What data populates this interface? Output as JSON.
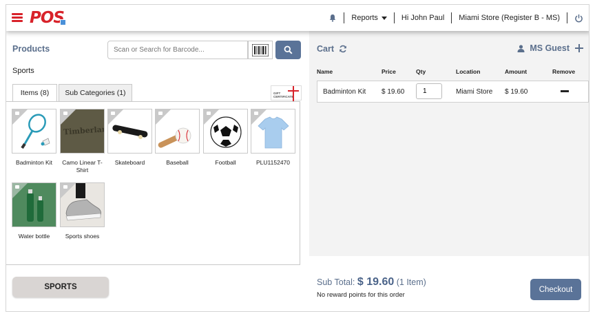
{
  "header": {
    "logo_text": "POS",
    "icons": {
      "menu": "hamburger-icon",
      "notifications": "bell-icon",
      "logout": "power-icon"
    },
    "reports_label": "Reports",
    "greeting": "Hi John Paul",
    "store": "Miami Store (Register B - MS)"
  },
  "products": {
    "title": "Products",
    "search_placeholder": "Scan or Search for Barcode...",
    "breadcrumb": "Sports",
    "tabs": [
      {
        "label": "Items (8)",
        "active": true
      },
      {
        "label": "Sub Categories (1)",
        "active": false
      }
    ],
    "gift_label_line1": "GIFT",
    "gift_label_line2": "CERTIFICATE",
    "items": [
      {
        "name": "Badminton Kit",
        "image": "badminton-icon"
      },
      {
        "name": "Camo Linear T-Shirt",
        "image": "tshirt-olive-icon",
        "thumb_text": "Timberland"
      },
      {
        "name": "Skateboard",
        "image": "skateboard-icon"
      },
      {
        "name": "Baseball",
        "image": "baseball-icon"
      },
      {
        "name": "Football",
        "image": "football-icon"
      },
      {
        "name": "PLU1152470",
        "image": "tshirt-blue-icon"
      },
      {
        "name": "Water bottle",
        "image": "water-bottle-icon"
      },
      {
        "name": "Sports shoes",
        "image": "shoe-icon"
      }
    ],
    "category_button": "SPORTS"
  },
  "cart": {
    "title": "Cart",
    "customer": "MS Guest",
    "columns": [
      "Name",
      "Price",
      "Qty",
      "Location",
      "Amount",
      "Remove"
    ],
    "rows": [
      {
        "name": "Badminton Kit",
        "price": "$ 19.60",
        "qty": "1",
        "location": "Miami Store",
        "amount": "$ 19.60"
      }
    ],
    "subtotal_label": "Sub Total:",
    "subtotal_amount": "$ 19.60",
    "subtotal_count": "(1 Item)",
    "reward_text": "No reward points for this order",
    "checkout_label": "Checkout"
  },
  "colors": {
    "brand_red": "#d8222a",
    "accent_blue": "#5a7398",
    "title_blue": "#5b6f8c"
  }
}
